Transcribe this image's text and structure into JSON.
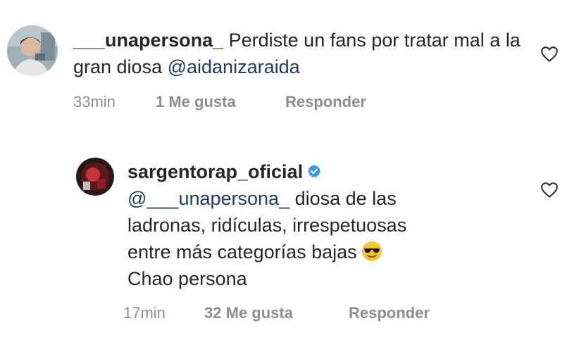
{
  "comments": [
    {
      "username": "___unapersona_",
      "text": "Perdiste un fans por tratar mal a la gran diosa ",
      "mention": "@aidanizaraida",
      "time": "33min",
      "likes": "1 Me gusta",
      "reply": "Responder",
      "verified": false
    },
    {
      "username": "sargentorap_oficial",
      "mention": "@___unapersona_",
      "line1_rest": " diosa de las",
      "line2": "ladronas, ridículas, irrespetuosas",
      "line3": "entre más categorías bajas",
      "line4": "Chao persona",
      "emoji": "sunglasses-emoji",
      "time": "17min",
      "likes": "32 Me gusta",
      "reply": "Responder",
      "verified": true
    }
  ],
  "icons": {
    "like": "heart-outline-icon",
    "verified": "verified-badge-icon"
  },
  "colors": {
    "verified": "#3897f0",
    "meta": "#8e8e8e",
    "text": "#262626"
  }
}
